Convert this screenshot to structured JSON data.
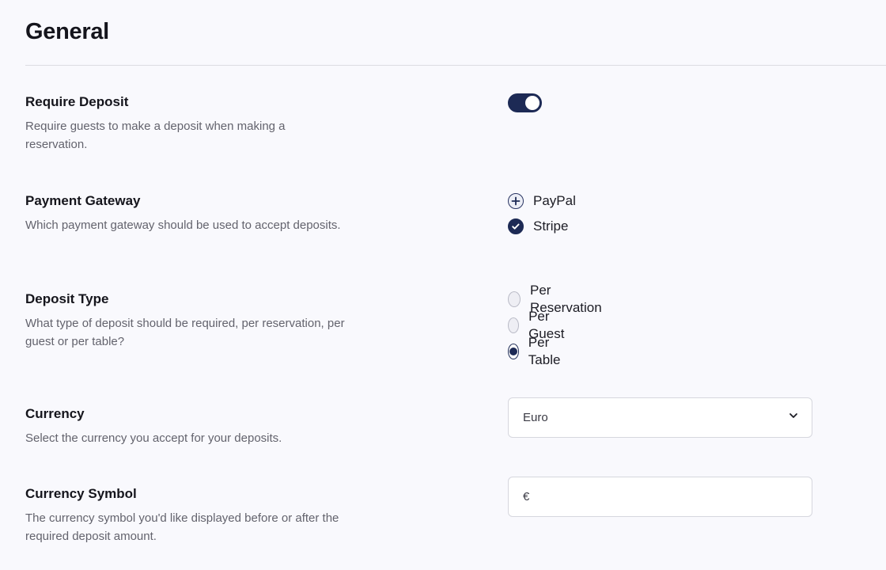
{
  "page": {
    "title": "General"
  },
  "sections": {
    "require_deposit": {
      "label": "Require Deposit",
      "description": "Require guests to make a deposit when making a reservation.",
      "enabled": true
    },
    "payment_gateway": {
      "label": "Payment Gateway",
      "description": "Which payment gateway should be used to accept deposits.",
      "options": [
        {
          "label": "PayPal",
          "state": "add",
          "icon": "plus-icon"
        },
        {
          "label": "Stripe",
          "state": "checked",
          "icon": "check-icon"
        }
      ]
    },
    "deposit_type": {
      "label": "Deposit Type",
      "description": "What type of deposit should be required, per reservation, per guest or per table?",
      "options": [
        {
          "label": "Per Reservation",
          "selected": false
        },
        {
          "label": "Per Guest",
          "selected": false
        },
        {
          "label": "Per Table",
          "selected": true
        }
      ]
    },
    "currency": {
      "label": "Currency",
      "description": "Select the currency you accept for your deposits.",
      "selected": "Euro"
    },
    "currency_symbol": {
      "label": "Currency Symbol",
      "description": "The currency symbol you'd like displayed before or after the required deposit amount.",
      "value": "€"
    }
  },
  "colors": {
    "accent": "#1d2a55",
    "background": "#f9f9fd",
    "muted_text": "#63636d"
  }
}
